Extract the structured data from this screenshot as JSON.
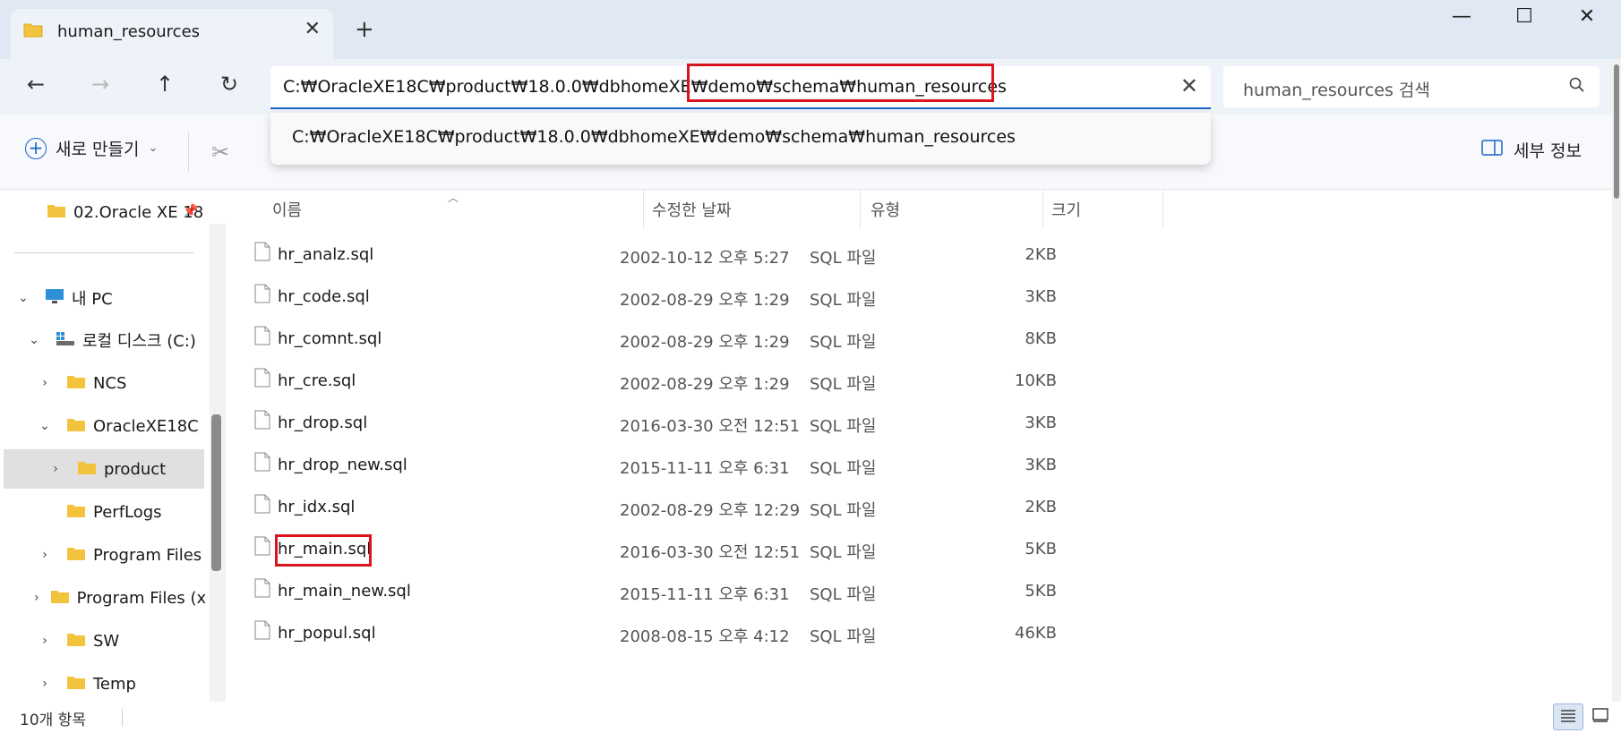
{
  "window": {
    "tab_title": "human_resources",
    "tab_close": "✕",
    "new_tab": "+",
    "minimize": "—",
    "maximize": "☐",
    "close": "✕"
  },
  "nav": {
    "back": "←",
    "forward": "→",
    "up": "↑",
    "refresh": "↻",
    "address_path": "C:₩OracleXE18C₩product₩18.0.0₩dbhomeXE₩demo₩schema₩human_resources",
    "address_clear": "✕",
    "search_placeholder": "human_resources 검색"
  },
  "suggestion": {
    "path": "C:₩OracleXE18C₩product₩18.0.0₩dbhomeXE₩demo₩schema₩human_resources"
  },
  "commandbar": {
    "new_label": "새로 만들기",
    "details_label": "세부 정보"
  },
  "sidebar": {
    "quick_item": "02.Oracle XE 18",
    "this_pc": "내 PC",
    "local_disk": "로컬 디스크 (C:)",
    "items": [
      {
        "label": "NCS",
        "expand": "›"
      },
      {
        "label": "OracleXE18C",
        "expand": "⌄"
      },
      {
        "label": "product",
        "expand": "›"
      },
      {
        "label": "PerfLogs",
        "expand": ""
      },
      {
        "label": "Program Files",
        "expand": "›"
      },
      {
        "label": "Program Files (x",
        "expand": "›"
      },
      {
        "label": "SW",
        "expand": "›"
      },
      {
        "label": "Temp",
        "expand": "›"
      }
    ]
  },
  "columns": {
    "name": "이름",
    "date": "수정한 날짜",
    "type": "유형",
    "size": "크기"
  },
  "files": [
    {
      "name": "hr_analz.sql",
      "date": "2002-10-12 오후 5:27",
      "type": "SQL 파일",
      "size": "2KB"
    },
    {
      "name": "hr_code.sql",
      "date": "2002-08-29 오후 1:29",
      "type": "SQL 파일",
      "size": "3KB"
    },
    {
      "name": "hr_comnt.sql",
      "date": "2002-08-29 오후 1:29",
      "type": "SQL 파일",
      "size": "8KB"
    },
    {
      "name": "hr_cre.sql",
      "date": "2002-08-29 오후 1:29",
      "type": "SQL 파일",
      "size": "10KB"
    },
    {
      "name": "hr_drop.sql",
      "date": "2016-03-30 오전 12:51",
      "type": "SQL 파일",
      "size": "3KB"
    },
    {
      "name": "hr_drop_new.sql",
      "date": "2015-11-11 오후 6:31",
      "type": "SQL 파일",
      "size": "3KB"
    },
    {
      "name": "hr_idx.sql",
      "date": "2002-08-29 오후 12:29",
      "type": "SQL 파일",
      "size": "2KB"
    },
    {
      "name": "hr_main.sql",
      "date": "2016-03-30 오전 12:51",
      "type": "SQL 파일",
      "size": "5KB"
    },
    {
      "name": "hr_main_new.sql",
      "date": "2015-11-11 오후 6:31",
      "type": "SQL 파일",
      "size": "5KB"
    },
    {
      "name": "hr_popul.sql",
      "date": "2008-08-15 오후 4:12",
      "type": "SQL 파일",
      "size": "46KB"
    }
  ],
  "status": {
    "item_count": "10개 항목"
  },
  "colors": {
    "highlight": "#d9141d",
    "accent": "#1a64c8",
    "folder": "#f3c33d"
  }
}
